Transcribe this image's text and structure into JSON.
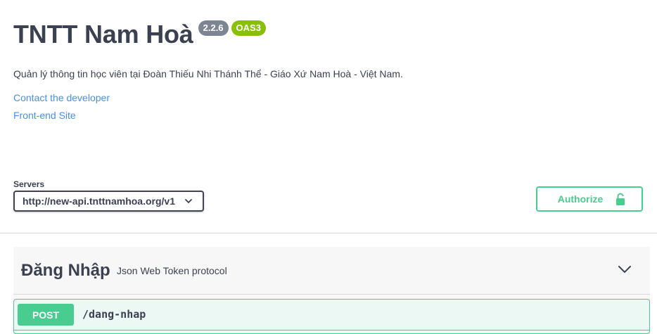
{
  "info": {
    "title": "TNTT Nam Hoà",
    "version": "2.2.6",
    "spec_badge": "OAS3",
    "description": "Quản lý thông tin học viên tại Đoàn Thiếu Nhi Thánh Thể - Giáo Xứ Nam Hoà - Việt Nam.",
    "links": {
      "contact": "Contact the developer",
      "frontend": "Front-end Site"
    }
  },
  "servers": {
    "label": "Servers",
    "selected": "http://new-api.tnttnamhoa.org/v1"
  },
  "authorize": {
    "label": "Authorize",
    "icon": "lock-icon"
  },
  "tag": {
    "name": "Đăng Nhập",
    "description": "Json Web Token protocol",
    "icon": "chevron-down-icon"
  },
  "operation": {
    "method": "POST",
    "path": "/dang-nhap"
  },
  "colors": {
    "text": "#3b4151",
    "link": "#4990e2",
    "post": "#49cc90",
    "post_bg": "#ecf8f3",
    "version_badge": "#7d8492",
    "oas_badge": "#89bf04"
  }
}
